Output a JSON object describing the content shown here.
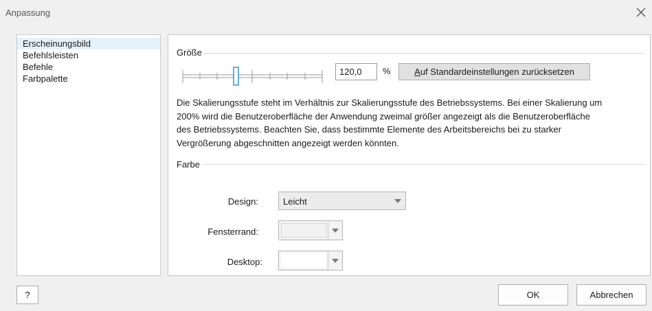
{
  "window": {
    "title": "Anpassung"
  },
  "sidebar": {
    "items": [
      {
        "label": "Erscheinungsbild",
        "selected": true
      },
      {
        "label": "Befehlsleisten",
        "selected": false
      },
      {
        "label": "Befehle",
        "selected": false
      },
      {
        "label": "Farbpalette",
        "selected": false
      }
    ]
  },
  "size_group": {
    "header": "Größe",
    "slider_level": 0.25,
    "percent_value": "120,0",
    "percent_sign": "%",
    "reset_mnemonic": "A",
    "reset_rest": "uf Standardeinstellungen zurücksetzen",
    "description": "Die Skalierungsstufe steht im Verhältnis zur Skalierungsstufe des Betriebssystems. Bei einer Skalierung um 200% wird die Benutzeroberfläche der Anwendung zweimal größer angezeigt als die Benutzeroberfläche des Betriebssystems. Beachten Sie, dass bestimmte Elemente des Arbeitsbereichs bei zu starker Vergrößerung abgeschnitten angezeigt werden könnten."
  },
  "color_group": {
    "header": "Farbe",
    "design_label": "Design:",
    "design_value": "Leicht",
    "border_label": "Fensterrand:",
    "border_color": "#f2f2f2",
    "desktop_label": "Desktop:",
    "desktop_color": "#ffffff"
  },
  "footer": {
    "help_label": "?",
    "ok_label": "OK",
    "cancel_label": "Abbrechen"
  },
  "colors": {
    "selection": "#e5f1fb",
    "slider_thumb": "#0078d7"
  }
}
